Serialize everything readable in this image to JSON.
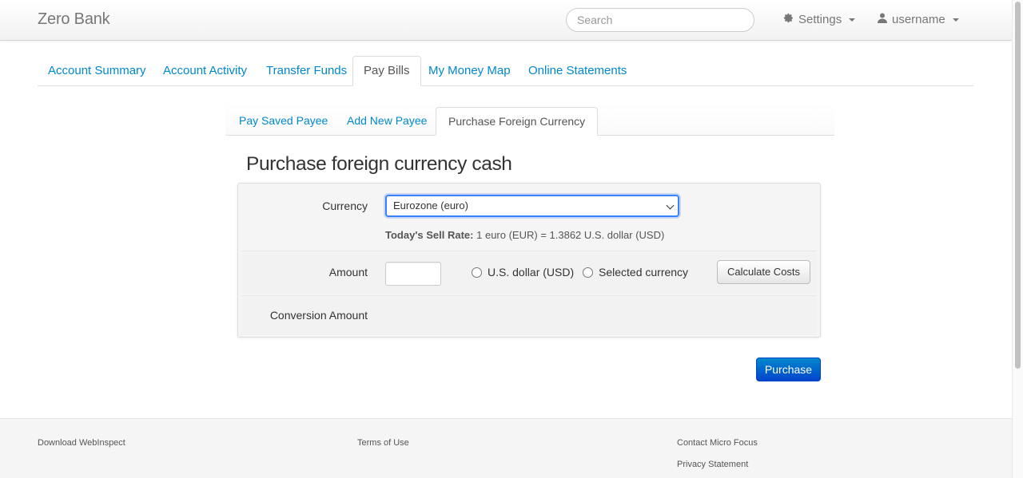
{
  "app": {
    "brand": "Zero Bank"
  },
  "header": {
    "search_placeholder": "Search",
    "settings_label": "Settings",
    "user_label": "username"
  },
  "main_tabs": [
    {
      "label": "Account Summary",
      "active": false
    },
    {
      "label": "Account Activity",
      "active": false
    },
    {
      "label": "Transfer Funds",
      "active": false
    },
    {
      "label": "Pay Bills",
      "active": true
    },
    {
      "label": "My Money Map",
      "active": false
    },
    {
      "label": "Online Statements",
      "active": false
    }
  ],
  "sub_tabs": [
    {
      "label": "Pay Saved Payee",
      "active": false
    },
    {
      "label": "Add New Payee",
      "active": false
    },
    {
      "label": "Purchase Foreign Currency",
      "active": true
    }
  ],
  "page": {
    "title": "Purchase foreign currency cash",
    "currency_label": "Currency",
    "currency_value": "Eurozone (euro)",
    "sell_rate_label": "Today's Sell Rate:",
    "sell_rate_value": "1 euro (EUR) = 1.3862 U.S. dollar (USD)",
    "amount_label": "Amount",
    "amount_value": "",
    "radio_usd_label": "U.S. dollar (USD)",
    "radio_selected_label": "Selected currency",
    "calculate_button": "Calculate Costs",
    "conversion_label": "Conversion Amount",
    "purchase_button": "Purchase"
  },
  "footer": {
    "download": "Download WebInspect",
    "terms": "Terms of Use",
    "contact": "Contact Micro Focus",
    "privacy": "Privacy Statement"
  }
}
